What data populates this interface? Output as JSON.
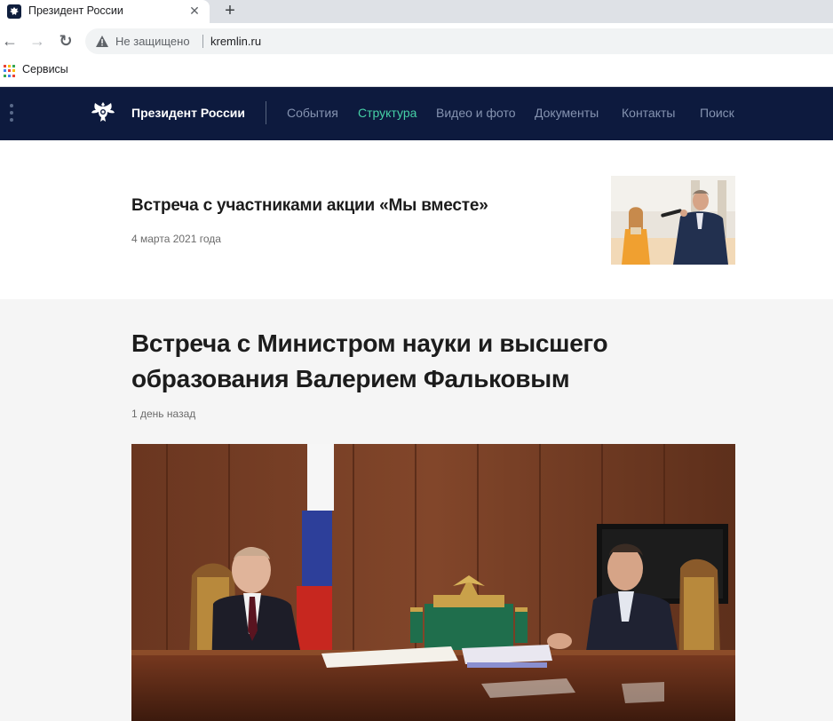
{
  "browser": {
    "tab_title": "Президент России",
    "tab_close": "✕",
    "new_tab": "+",
    "back": "←",
    "forward": "→",
    "reload": "↻",
    "security_label": "Не защищено",
    "url": "kremlin.ru",
    "bookmarks_apps_label": "Сервисы"
  },
  "header": {
    "site_title": "Президент России",
    "nav": [
      {
        "label": "События"
      },
      {
        "label": "Структура",
        "active": true
      },
      {
        "label": "Видео и фото"
      },
      {
        "label": "Документы"
      },
      {
        "label": "Контакты"
      },
      {
        "label": "Поиск"
      }
    ]
  },
  "news": [
    {
      "title": "Встреча с участниками акции «Мы вместе»",
      "date": "4 марта 2021 года"
    }
  ],
  "featured": {
    "title": "Встреча с Министром науки и высшего образования Валерием Фальковым",
    "date": "1 день назад"
  },
  "colors": {
    "header_bg": "#0d1a3e",
    "nav_text": "#8593b0",
    "nav_active": "#46d1a6",
    "featured_bg": "#f5f5f5"
  }
}
